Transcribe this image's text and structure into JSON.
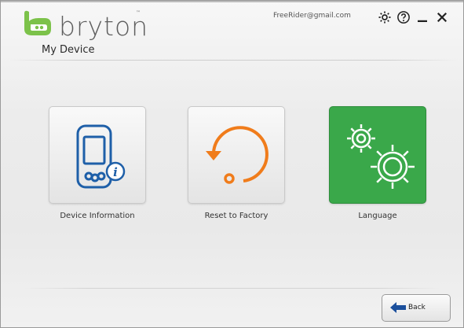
{
  "header": {
    "logo_text": "bryton",
    "logo_tm": "™",
    "page_title": "My Device",
    "user_email": "FreeRider@gmail.com"
  },
  "window_controls": [
    {
      "name": "settings",
      "icon": "gear-icon"
    },
    {
      "name": "help",
      "icon": "help-icon"
    },
    {
      "name": "minimize",
      "icon": "minimize-icon"
    },
    {
      "name": "close",
      "icon": "close-icon"
    }
  ],
  "tiles": [
    {
      "label": "Device Information",
      "icon": "device-info-icon",
      "selected": false
    },
    {
      "label": "Reset to Factory",
      "icon": "reset-icon",
      "selected": false
    },
    {
      "label": "Language",
      "icon": "gears-icon",
      "selected": true
    }
  ],
  "footer": {
    "back_label": "Back",
    "back_icon": "arrow-left-icon"
  },
  "colors": {
    "brand_green": "#3aa84a",
    "icon_blue": "#1e5fa8",
    "icon_orange": "#f07c1b",
    "back_arrow_blue": "#1b4f9c"
  }
}
